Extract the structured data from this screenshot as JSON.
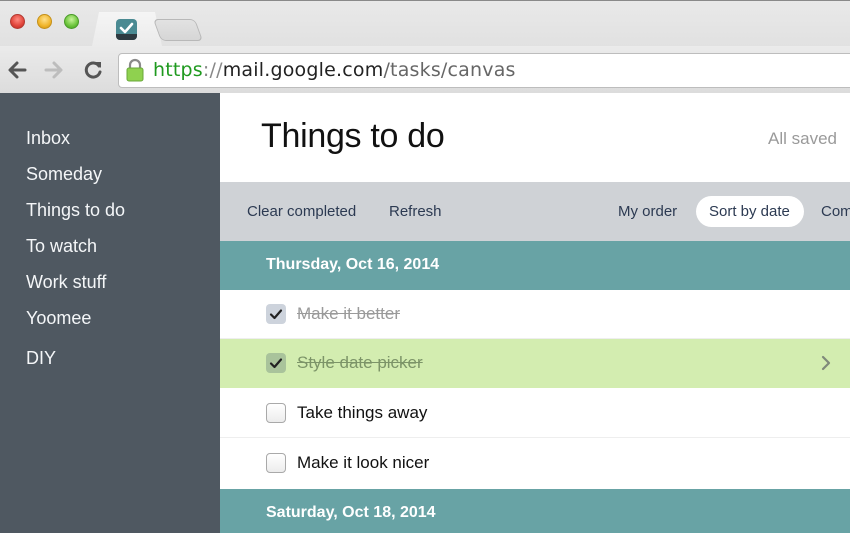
{
  "browser": {
    "tab_favicon": "tasks-checkmark-icon",
    "url": {
      "scheme": "https",
      "separator": "://",
      "host": "mail.google.com",
      "path": "/tasks/canvas"
    },
    "icons": {
      "back": "arrow-left-icon",
      "forward": "arrow-right-icon",
      "reload": "reload-icon",
      "secure": "lock-icon"
    }
  },
  "sidebar": {
    "items": [
      {
        "label": "Inbox"
      },
      {
        "label": "Someday"
      },
      {
        "label": "Things to do"
      },
      {
        "label": "To watch"
      },
      {
        "label": "Work stuff"
      },
      {
        "label": "Yoomee"
      },
      {
        "label": "DIY"
      }
    ]
  },
  "main": {
    "title": "Things to do",
    "save_status": "All saved",
    "actions": {
      "clear_completed": "Clear completed",
      "refresh": "Refresh",
      "my_order": "My order",
      "sort_by_date": "Sort by date",
      "completed_partial": "Com"
    },
    "active_sort": "Sort by date",
    "groups": [
      {
        "date": "Thursday, Oct 16, 2014",
        "tasks": [
          {
            "title": "Make it better",
            "completed": true,
            "selected": false
          },
          {
            "title": "Style date picker",
            "completed": true,
            "selected": true
          },
          {
            "title": "Take things away",
            "completed": false,
            "selected": false
          },
          {
            "title": "Make it look nicer",
            "completed": false,
            "selected": false
          }
        ]
      },
      {
        "date": "Saturday, Oct 18, 2014",
        "tasks": []
      }
    ]
  },
  "colors": {
    "sidebar_bg": "#4f5861",
    "group_header_bg": "#68a3a5",
    "selected_row_bg": "#d3edb0",
    "actionbar_bg": "#cfd2d6",
    "url_scheme": "#1f9a1f"
  }
}
